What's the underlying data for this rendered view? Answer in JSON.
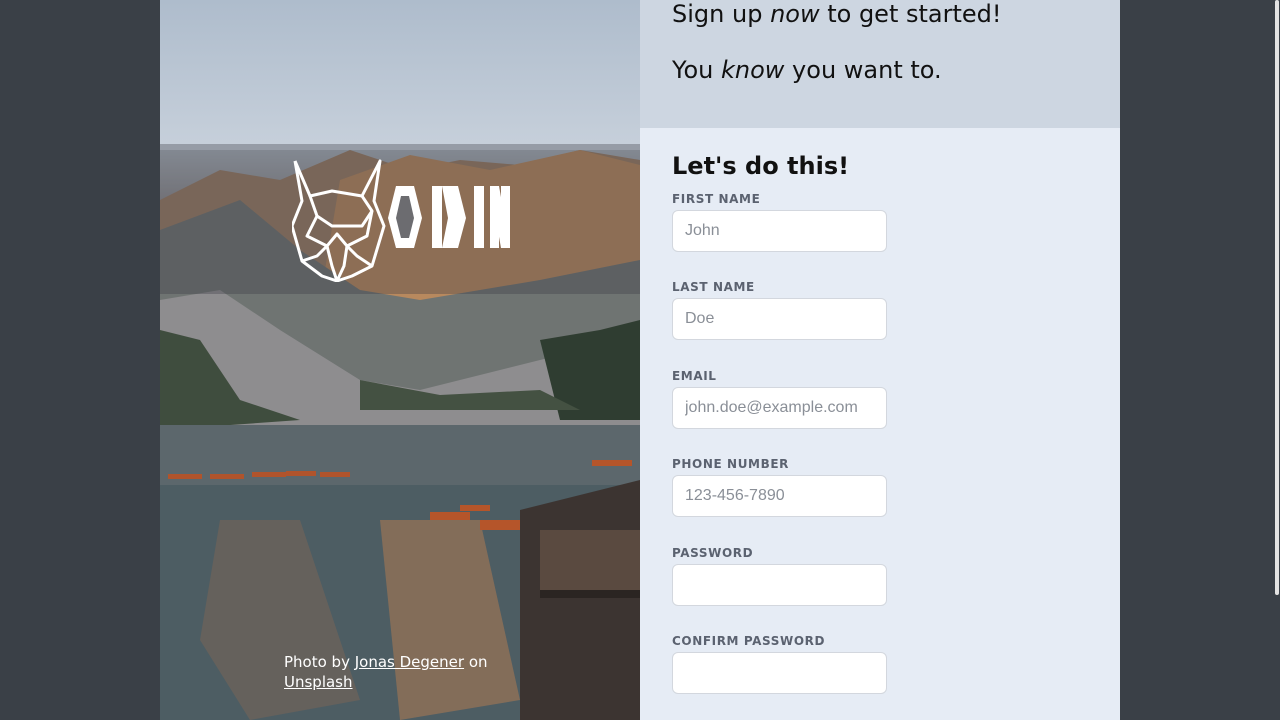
{
  "hero": {
    "line1_prefix": "Sign up ",
    "line1_emph": "now",
    "line1_suffix": " to get started!",
    "line2_prefix": "You ",
    "line2_emph": "know",
    "line2_suffix": " you want to."
  },
  "logo": {
    "text": "ODIN"
  },
  "credit": {
    "prefix": "Photo by ",
    "author": "Jonas Degener",
    "middle": " on ",
    "site": "Unsplash"
  },
  "form": {
    "title": "Let's do this!",
    "fields": [
      {
        "label": "FIRST NAME",
        "placeholder": "John",
        "value": ""
      },
      {
        "label": "LAST NAME",
        "placeholder": "Doe",
        "value": ""
      },
      {
        "label": "EMAIL",
        "placeholder": "john.doe@example.com",
        "value": ""
      },
      {
        "label": "PHONE NUMBER",
        "placeholder": "123-456-7890",
        "value": ""
      },
      {
        "label": "PASSWORD",
        "placeholder": "",
        "value": ""
      },
      {
        "label": "CONFIRM PASSWORD",
        "placeholder": "",
        "value": ""
      }
    ]
  },
  "colors": {
    "page_bg": "#3a4047",
    "hero_bg": "#cdd6e1",
    "form_bg": "#e6ecf5",
    "label": "#5b6270"
  }
}
